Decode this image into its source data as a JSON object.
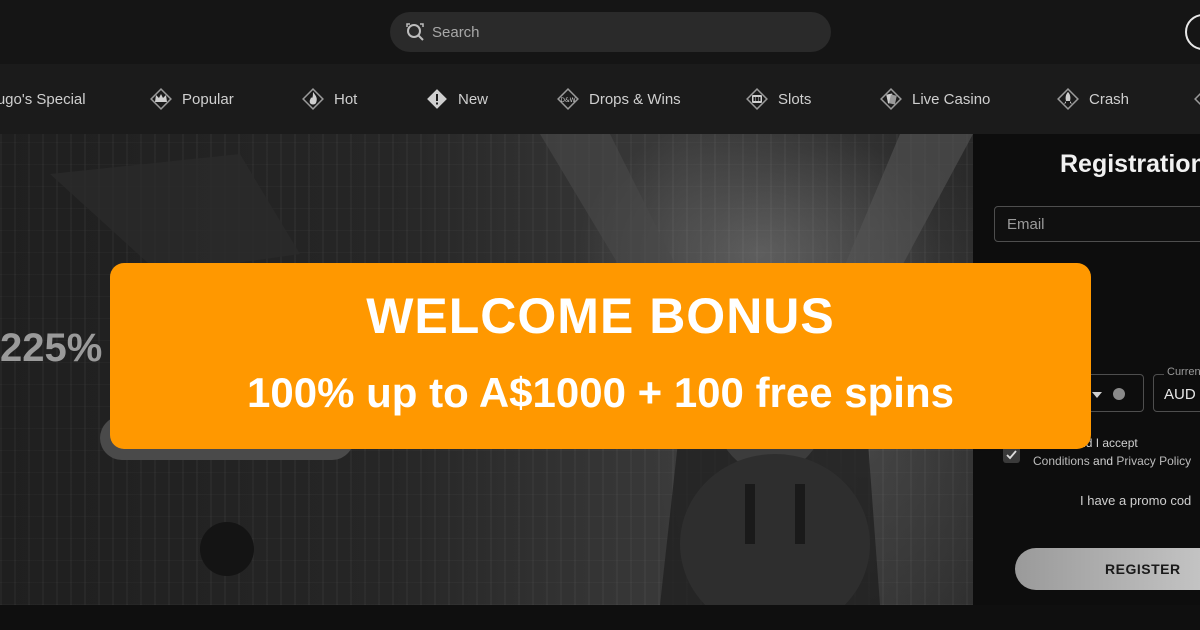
{
  "search": {
    "placeholder": "Search"
  },
  "categories": [
    {
      "label": "Hugo's Special",
      "icon": "hugo-icon"
    },
    {
      "label": "Popular",
      "icon": "crown-icon"
    },
    {
      "label": "Hot",
      "icon": "flame-icon"
    },
    {
      "label": "New",
      "icon": "exclamation-icon"
    },
    {
      "label": "Drops & Wins",
      "icon": "drops-wins-icon"
    },
    {
      "label": "Slots",
      "icon": "slot-machine-icon"
    },
    {
      "label": "Live Casino",
      "icon": "cards-icon"
    },
    {
      "label": "Crash",
      "icon": "rocket-icon"
    }
  ],
  "hero": {
    "bonus_percent_text": "225%"
  },
  "registration": {
    "title": "Registration",
    "email_placeholder": "Email",
    "currency_label": "Currency",
    "currency_value": "AUD",
    "terms_text": "ars old and I accept",
    "terms_link_1": "Conditions",
    "terms_and": "and",
    "terms_link_2": "Privacy Policy",
    "promo_text": "I have a promo cod",
    "register_label": "REGISTER"
  },
  "banner": {
    "line1": "WELCOME BONUS",
    "line2": "100% up to A$1000 + 100 free spins"
  },
  "colors": {
    "banner": "#ff9800",
    "background": "#111111"
  }
}
